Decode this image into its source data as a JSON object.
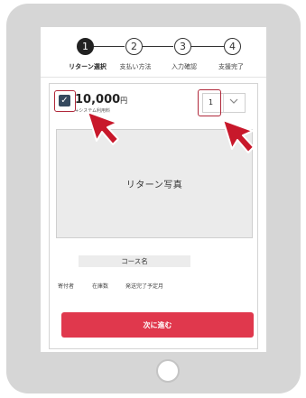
{
  "stepper": {
    "steps": [
      {
        "number": "1",
        "label": "リターン選択"
      },
      {
        "number": "2",
        "label": "支払い方法"
      },
      {
        "number": "3",
        "label": "入力確認"
      },
      {
        "number": "4",
        "label": "支援完了"
      }
    ]
  },
  "reward": {
    "price": "10,000",
    "currency": "円",
    "fee_note": "+システム利用料",
    "quantity": "1",
    "photo_placeholder": "リターン写真",
    "course_name": "コース名",
    "meta": [
      "寄付者",
      "在庫数",
      "発送完了予定月"
    ]
  },
  "actions": {
    "next_label": "次に進む"
  },
  "colors": {
    "accent": "#e0384d",
    "checkbox": "#35495e",
    "highlight": "#b0283a",
    "cursor": "#c8182b"
  },
  "icons": {
    "check": "check-icon",
    "chevron": "chevron-down-icon",
    "cursor": "pointer-cursor-icon"
  }
}
